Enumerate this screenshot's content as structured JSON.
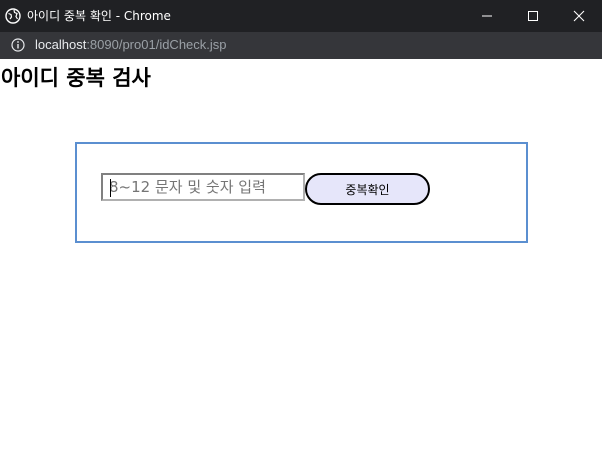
{
  "window": {
    "title": "아이디 중복 확인 - Chrome",
    "controls": {
      "minimize": "minimize",
      "maximize": "maximize",
      "close": "close"
    }
  },
  "address_bar": {
    "host": "localhost",
    "path": ":8090/pro01/idCheck.jsp"
  },
  "page": {
    "title": "아이디 중복 검사",
    "form": {
      "id_input": {
        "value": "",
        "placeholder": "8~12 문자 및 숫자 입력"
      },
      "check_button_label": "중복확인"
    }
  },
  "colors": {
    "titlebar_bg": "#202124",
    "addressbar_bg": "#35363a",
    "box_border": "#5b8fd0",
    "button_bg": "#e6e6fa",
    "button_border": "#000000"
  }
}
